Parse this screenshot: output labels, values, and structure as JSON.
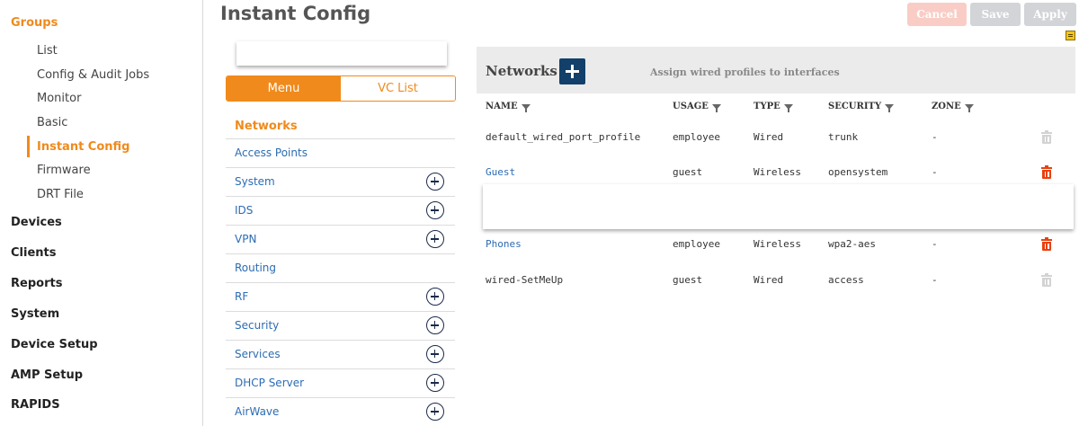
{
  "sidebar": {
    "top_items": [
      {
        "label": "Groups"
      },
      {
        "label": "Devices"
      },
      {
        "label": "Clients"
      },
      {
        "label": "Reports"
      },
      {
        "label": "System"
      },
      {
        "label": "Device Setup"
      },
      {
        "label": "AMP Setup"
      },
      {
        "label": "RAPIDS"
      }
    ],
    "group_items": [
      {
        "label": "List"
      },
      {
        "label": "Config & Audit Jobs"
      },
      {
        "label": "Monitor"
      },
      {
        "label": "Basic"
      },
      {
        "label": "Instant Config"
      },
      {
        "label": "Firmware"
      },
      {
        "label": "DRT File"
      }
    ],
    "active_item": "Instant Config"
  },
  "header": {
    "title": "Instant Config",
    "buttons": {
      "cancel": "Cancel",
      "save": "Save",
      "apply": "Apply"
    }
  },
  "left_menu": {
    "tabs": {
      "menu": "Menu",
      "vc_list": "VC List"
    },
    "selected_tab": "Menu",
    "heading": "Networks",
    "items": [
      {
        "label": "Access Points",
        "has_add": false
      },
      {
        "label": "System",
        "has_add": true
      },
      {
        "label": "IDS",
        "has_add": true
      },
      {
        "label": "VPN",
        "has_add": true
      },
      {
        "label": "Routing",
        "has_add": false
      },
      {
        "label": "RF",
        "has_add": true
      },
      {
        "label": "Security",
        "has_add": true
      },
      {
        "label": "Services",
        "has_add": true
      },
      {
        "label": "DHCP Server",
        "has_add": true
      },
      {
        "label": "AirWave",
        "has_add": true
      }
    ]
  },
  "networks_panel": {
    "title": "Networks",
    "subtitle": "Assign wired profiles to interfaces",
    "columns": [
      "NAME",
      "USAGE",
      "TYPE",
      "SECURITY",
      "ZONE"
    ],
    "rows": [
      {
        "name": "default_wired_port_profile",
        "usage": "employee",
        "type": "Wired",
        "security": "trunk",
        "zone": "-",
        "is_link": false,
        "can_delete": false
      },
      {
        "name": "Guest",
        "usage": "guest",
        "type": "Wireless",
        "security": "opensystem",
        "zone": "-",
        "is_link": true,
        "can_delete": true
      },
      {
        "name": "Phones",
        "usage": "employee",
        "type": "Wireless",
        "security": "wpa2-aes",
        "zone": "-",
        "is_link": true,
        "can_delete": true
      },
      {
        "name": "wired-SetMeUp",
        "usage": "guest",
        "type": "Wired",
        "security": "access",
        "zone": "-",
        "is_link": false,
        "can_delete": false
      }
    ]
  },
  "colors": {
    "accent_orange": "#f08a1c",
    "link_blue": "#2c6cb3",
    "add_button_navy": "#12406a",
    "delete_red": "#e8410f"
  }
}
